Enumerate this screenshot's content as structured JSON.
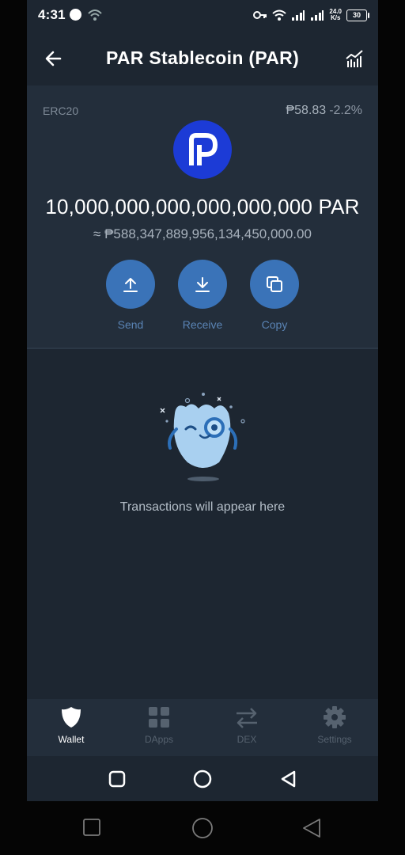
{
  "status_bar": {
    "time": "4:31",
    "network_speed_value": "24.0",
    "network_speed_unit": "K/s",
    "battery": "30"
  },
  "header": {
    "title": "PAR Stablecoin (PAR)",
    "back_icon": "arrow-left-icon",
    "chart_icon": "chart-icon"
  },
  "token": {
    "network": "ERC20",
    "price": "₱58.83",
    "price_change": "-2.2%",
    "balance": "10,000,000,000,000,000,000 PAR",
    "fiat_value": "≈ ₱588,347,889,956,134,450,000.00",
    "logo_icon": "par-logo-icon"
  },
  "actions": [
    {
      "label": "Send",
      "icon": "upload-arrow-icon"
    },
    {
      "label": "Receive",
      "icon": "download-arrow-icon"
    },
    {
      "label": "Copy",
      "icon": "copy-icon"
    }
  ],
  "empty_state": {
    "message": "Transactions will appear here",
    "illustration": "monocle-ghost-illustration"
  },
  "bottom_nav": [
    {
      "label": "Wallet",
      "icon": "shield-icon",
      "active": true
    },
    {
      "label": "DApps",
      "icon": "grid-icon",
      "active": false
    },
    {
      "label": "DEX",
      "icon": "swap-arrows-icon",
      "active": false
    },
    {
      "label": "Settings",
      "icon": "gear-icon",
      "active": false
    }
  ],
  "colors": {
    "background": "#1d2631",
    "panel": "#232e3b",
    "action_blue": "#3a73b8",
    "coin_blue": "#1c3bd6",
    "price_change": "#8c96a3"
  }
}
